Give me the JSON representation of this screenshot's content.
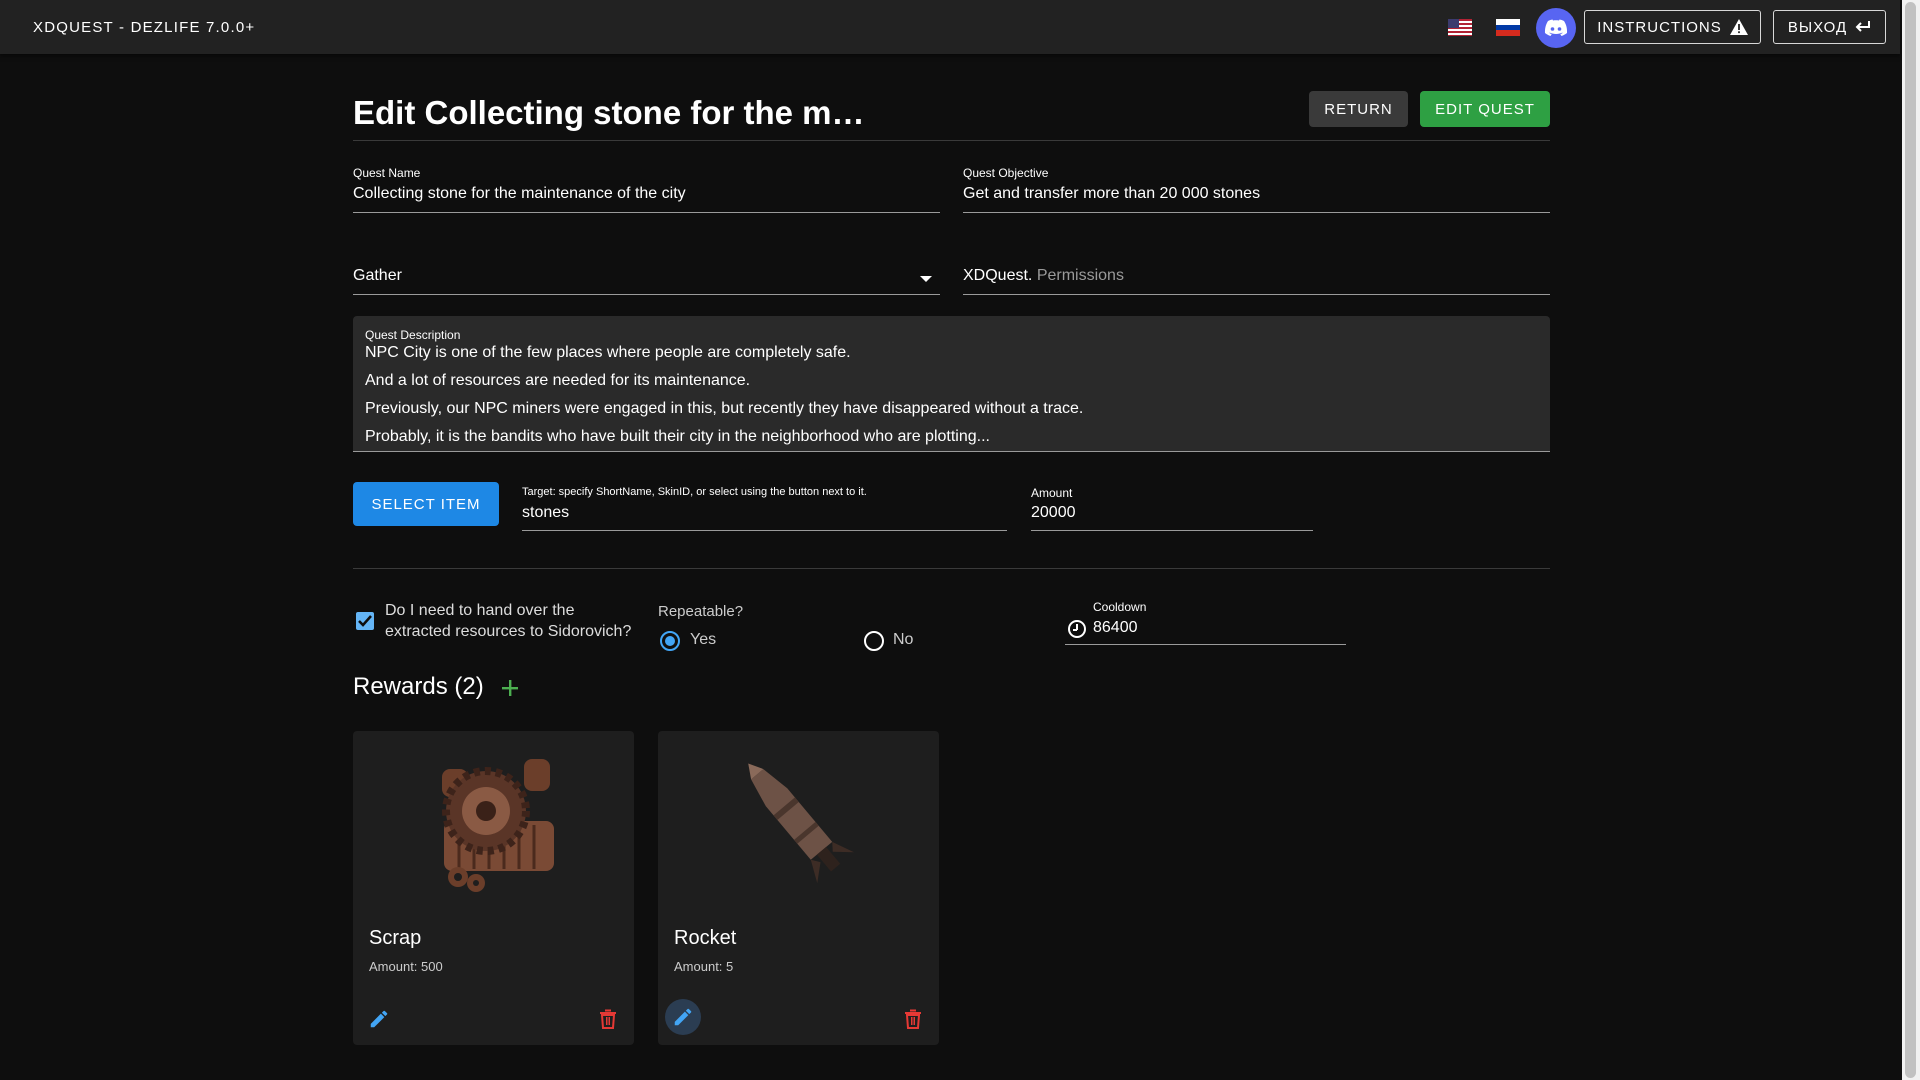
{
  "app": {
    "title": "XDQUEST - DEZLIFE 7.0.0+"
  },
  "topbar": {
    "instructions_label": "INSTRUCTIONS",
    "exit_label": "ВЫХОД"
  },
  "header": {
    "title": "Edit Collecting stone for the m…",
    "return_label": "RETURN",
    "edit_label": "EDIT QUEST"
  },
  "form": {
    "quest_name": {
      "label": "Quest Name",
      "value": "Collecting stone for the maintenance of the city"
    },
    "quest_objective": {
      "label": "Quest Objective",
      "value": "Get and transfer more than 20 000 stones"
    },
    "quest_type": {
      "value": "Gather"
    },
    "permissions": {
      "prefix": "XDQuest.",
      "placeholder": "Permissions"
    },
    "description": {
      "label": "Quest Description",
      "lines": [
        "NPC City is one of the few places where people are completely safe.",
        "And a lot of resources are needed for its maintenance.",
        "Previously, our NPC miners were engaged in this, but recently they have disappeared without a trace.",
        "Probably, it is the bandits who have built their city in the neighborhood who are plotting..."
      ]
    },
    "select_item_label": "SELECT ITEM",
    "target": {
      "label": "Target: specify ShortName, SkinID, or select using the button next to it.",
      "value": "stones"
    },
    "amount": {
      "label": "Amount",
      "value": "20000"
    },
    "hand_over": {
      "label": "Do I need to hand over the extracted resources to Sidorovich?",
      "checked": true
    },
    "repeatable": {
      "label": "Repeatable?",
      "yes_label": "Yes",
      "no_label": "No",
      "selected": "Yes"
    },
    "cooldown": {
      "label": "Cooldown",
      "value": "86400"
    }
  },
  "rewards": {
    "title": "Rewards (2)",
    "items": [
      {
        "name": "Scrap",
        "amount": "Amount: 500"
      },
      {
        "name": "Rocket",
        "amount": "Amount: 5"
      }
    ]
  },
  "colors": {
    "accent_blue": "#1e88e5",
    "accent_green": "#2ea043",
    "delete_red": "#e53935",
    "add_green": "#4caf50"
  }
}
